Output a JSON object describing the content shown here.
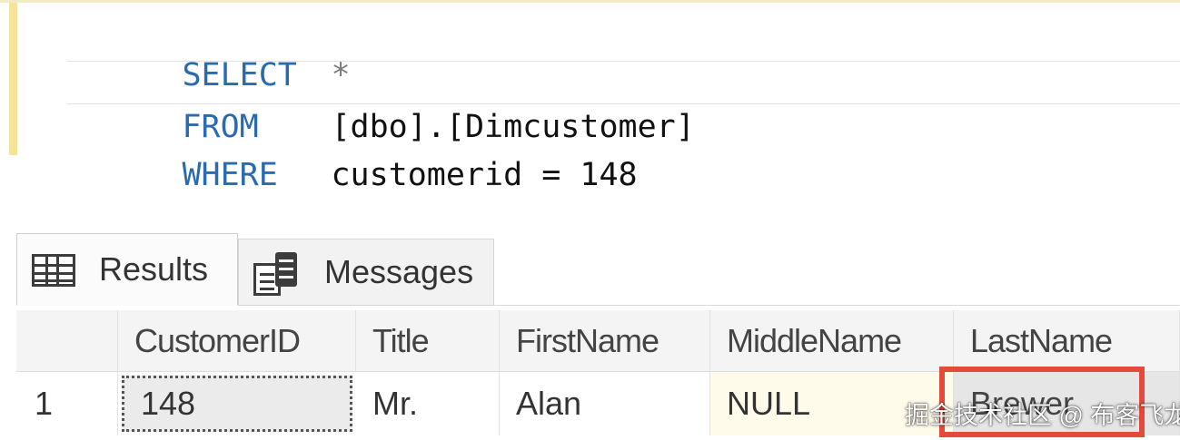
{
  "editor": {
    "lines": [
      {
        "keyword": "SELECT",
        "rest": "*"
      },
      {
        "keyword": "FROM",
        "rest": "[dbo].[Dimcustomer]"
      },
      {
        "keyword": "WHERE",
        "rest": "customerid = 148"
      }
    ]
  },
  "tabs": {
    "results_label": "Results",
    "messages_label": "Messages",
    "results_icon": "grid-icon",
    "messages_icon": "messages-icon"
  },
  "results": {
    "columns": [
      "",
      "CustomerID",
      "Title",
      "FirstName",
      "MiddleName",
      "LastName"
    ],
    "rows": [
      [
        "1",
        "148",
        "Mr.",
        "Alan",
        "NULL",
        "Brewer"
      ]
    ]
  },
  "annotation": {
    "highlight_color": "#e24a3b"
  },
  "watermark": "掘金技术社区 @ 布客飞龙"
}
